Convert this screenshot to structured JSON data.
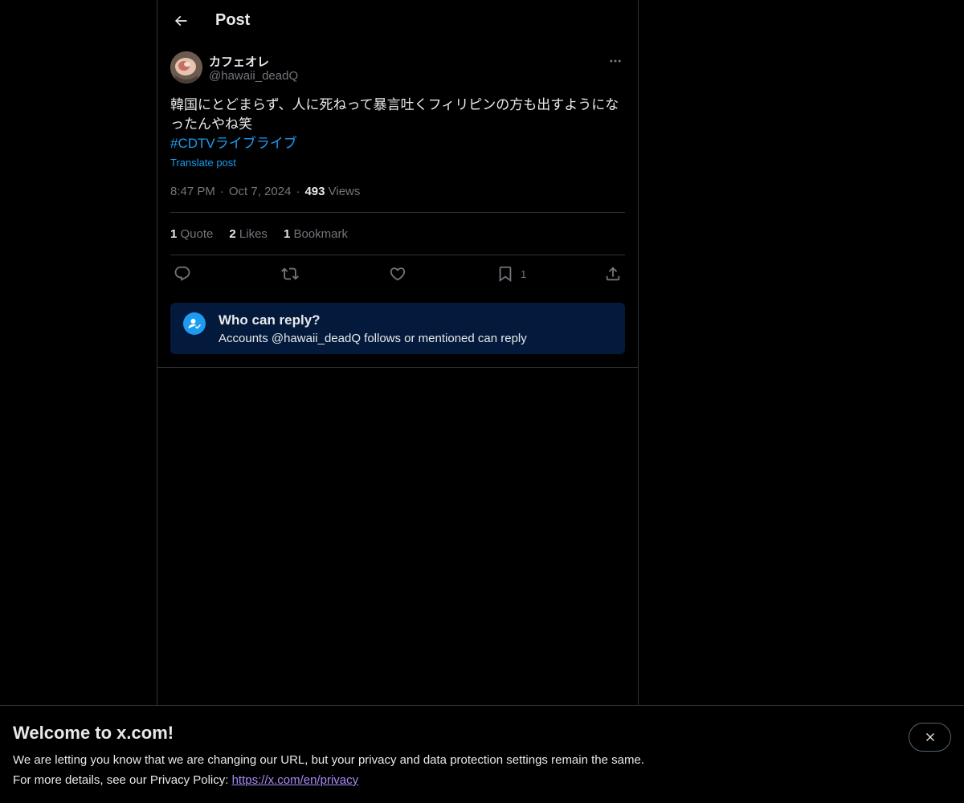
{
  "header": {
    "title": "Post"
  },
  "post": {
    "author": {
      "display_name": "カフェオレ",
      "handle": "@hawaii_deadQ"
    },
    "text_line": "韓国にとどまらず、人に死ねって暴言吐くフィリピンの方も出すようになったんやね笑",
    "hashtag": "#CDTVライブライブ",
    "translate_label": "Translate post",
    "time": "8:47 PM",
    "date": "Oct 7, 2024",
    "views_count": "493",
    "views_label": "Views",
    "stats": {
      "quotes_count": "1",
      "quotes_label": "Quote",
      "likes_count": "2",
      "likes_label": "Likes",
      "bookmarks_count": "1",
      "bookmarks_label": "Bookmark"
    },
    "actions": {
      "reply_icon": "reply-icon",
      "repost_icon": "repost-icon",
      "like_icon": "heart-icon",
      "bookmark_icon": "bookmark-icon",
      "bookmark_count": "1",
      "share_icon": "share-icon"
    }
  },
  "reply_restriction": {
    "title": "Who can reply?",
    "description": "Accounts @hawaii_deadQ follows or mentioned can reply"
  },
  "banner": {
    "title": "Welcome to x.com!",
    "line1": "We are letting you know that we are changing our URL, but your privacy and data protection settings remain the same.",
    "line2_prefix": "For more details, see our Privacy Policy: ",
    "link": "https://x.com/en/privacy"
  },
  "colors": {
    "background": "#000000",
    "accent": "#1d9bf0",
    "muted": "#71767b",
    "reply_box": "#031a3c"
  }
}
